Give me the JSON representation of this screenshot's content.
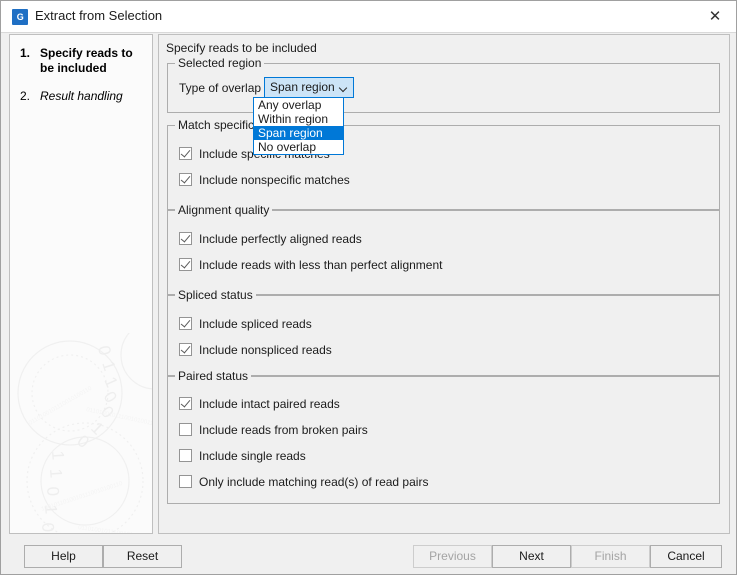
{
  "window": {
    "title": "Extract from Selection",
    "icon": "app-logo-icon",
    "icon_letter": "G",
    "close_label": "✕"
  },
  "sidebar": {
    "steps": [
      {
        "number": "1.",
        "label": "Specify reads to be included",
        "state": "current"
      },
      {
        "number": "2.",
        "label": "Result handling",
        "state": "upcoming"
      }
    ]
  },
  "main": {
    "header": "Specify reads to be included",
    "groups": [
      {
        "title": "Selected region",
        "combo": {
          "label": "Type of overlap",
          "value": "Span region",
          "options": [
            "Any overlap",
            "Within region",
            "Span region",
            "No overlap"
          ],
          "selected_option": "Span region",
          "expanded": true
        }
      },
      {
        "title": "Match specificity",
        "checkboxes": [
          {
            "label": "Include specific matches",
            "checked": true
          },
          {
            "label": "Include nonspecific matches",
            "checked": true
          }
        ]
      },
      {
        "title": "Alignment quality",
        "checkboxes": [
          {
            "label": "Include perfectly aligned reads",
            "checked": true
          },
          {
            "label": "Include reads with less than perfect alignment",
            "checked": true
          }
        ]
      },
      {
        "title": "Spliced status",
        "checkboxes": [
          {
            "label": "Include spliced reads",
            "checked": true
          },
          {
            "label": "Include nonspliced reads",
            "checked": true
          }
        ]
      },
      {
        "title": "Paired status",
        "checkboxes": [
          {
            "label": "Include intact paired reads",
            "checked": true
          },
          {
            "label": "Include reads from broken pairs",
            "checked": false
          },
          {
            "label": "Include single reads",
            "checked": false
          },
          {
            "label": "Only include matching read(s) of read pairs",
            "checked": false
          }
        ]
      }
    ]
  },
  "buttons": {
    "help": {
      "label": "Help",
      "enabled": true
    },
    "reset": {
      "label": "Reset",
      "enabled": true
    },
    "previous": {
      "label": "Previous",
      "enabled": false
    },
    "next": {
      "label": "Next",
      "enabled": true
    },
    "finish": {
      "label": "Finish",
      "enabled": false
    },
    "cancel": {
      "label": "Cancel",
      "enabled": true
    }
  },
  "colors": {
    "accent": "#0078d7",
    "combo_background": "#cce4f7",
    "dialog_background": "#f0f0f0",
    "panel_background": "#fbfbfb",
    "border": "#adadad"
  }
}
